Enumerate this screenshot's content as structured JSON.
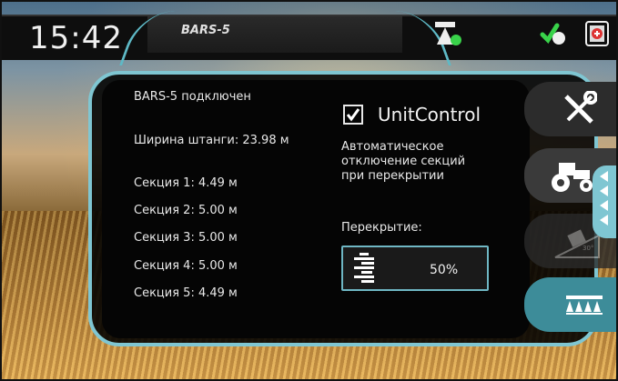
{
  "statusbar": {
    "time": "15:42",
    "device_tab": "BARS-5",
    "icons": [
      "gps-antenna-icon",
      "gps-signal-icon",
      "alert-icon"
    ],
    "accent_color": "#5eb9c6",
    "status_green": "#39d34a"
  },
  "info": {
    "connected": "BARS-5 подключен",
    "boom_width": "Ширина штанги: 23.98 м",
    "sections": [
      "Секция 1: 4.49 м",
      "Секция 2: 5.00 м",
      "Секция 3: 5.00 м",
      "Секция 4: 5.00 м",
      "Секция 5: 4.49 м"
    ]
  },
  "unitcontrol": {
    "checked": true,
    "label": "UnitControl",
    "desc_line1": "Автоматическое",
    "desc_line2": "отключение секций",
    "desc_line3": "при перекрытии",
    "overlap_label": "Перекрытие:",
    "overlap_value": "50%"
  },
  "sidebar": {
    "buttons": [
      "tools-icon",
      "tractor-icon",
      "tilt-icon",
      "sprayer-icon"
    ],
    "tilt_label": "30°"
  }
}
